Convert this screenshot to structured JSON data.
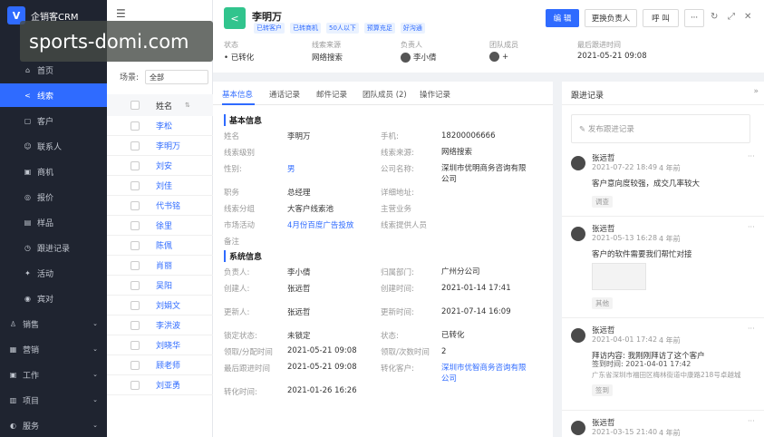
{
  "app": {
    "name": "企销客CRM",
    "logo_letter": "V"
  },
  "watermark": "sports-domi.com",
  "nav": {
    "items": [
      {
        "label": "首页",
        "icon": "home-icon",
        "glyph": "⌂"
      },
      {
        "label": "线索",
        "icon": "share-icon",
        "glyph": "<"
      },
      {
        "label": "客户",
        "icon": "customer-icon",
        "glyph": "▢"
      },
      {
        "label": "联系人",
        "icon": "contact-icon",
        "glyph": "☺"
      },
      {
        "label": "商机",
        "icon": "opportunity-icon",
        "glyph": "▣"
      },
      {
        "label": "报价",
        "icon": "quote-icon",
        "glyph": "◎"
      },
      {
        "label": "样品",
        "icon": "sample-icon",
        "glyph": "▤"
      },
      {
        "label": "跟进记录",
        "icon": "followup-icon",
        "glyph": "◷"
      },
      {
        "label": "活动",
        "icon": "activity-icon",
        "glyph": "✦"
      },
      {
        "label": "宾对",
        "icon": "compare-icon",
        "glyph": "◉"
      }
    ],
    "groups": [
      {
        "label": "销售",
        "icon": "sales-icon",
        "glyph": "♙"
      },
      {
        "label": "营销",
        "icon": "marketing-icon",
        "glyph": "▦"
      },
      {
        "label": "工作",
        "icon": "work-icon",
        "glyph": "▣"
      },
      {
        "label": "项目",
        "icon": "project-icon",
        "glyph": "▥"
      },
      {
        "label": "服务",
        "icon": "service-icon",
        "glyph": "◐"
      }
    ]
  },
  "list": {
    "scene_label": "场景:",
    "scene_value": "全部",
    "name_header": "姓名",
    "rows": [
      "李松",
      "李明万",
      "刘安",
      "刘佳",
      "代书铭",
      "徐里",
      "陈佩",
      "肖丽",
      "吴阳",
      "刘娟文",
      "李洪波",
      "刘晓华",
      "顾老师",
      "刘亚勇"
    ]
  },
  "record": {
    "title": "李明万",
    "tags": [
      "已转客户",
      "已转商机",
      "50人以下",
      "预算充足",
      "好沟通"
    ],
    "actions": {
      "edit": "编 辑",
      "owner": "更换负责人",
      "call": "呼 叫",
      "more": "···"
    },
    "summary": [
      {
        "label": "状态",
        "value": "已转化"
      },
      {
        "label": "线索来源",
        "value": "网络搜索"
      },
      {
        "label": "负责人",
        "value": "李小倩"
      },
      {
        "label": "团队成员",
        "value": "+"
      },
      {
        "label": "最后跟进时间",
        "value": "2021-05-21 09:08"
      }
    ]
  },
  "tabs": [
    "基本信息",
    "通话记录",
    "邮件记录",
    "团队成员 (2)",
    "操作记录"
  ],
  "basic": {
    "section_title": "基本信息",
    "fields": [
      {
        "label": "姓名",
        "value": "李明万",
        "label2": "手机:",
        "value2": "18200006666"
      },
      {
        "label": "线索级别",
        "value": "",
        "label2": "线索来源:",
        "value2": "网络搜索"
      },
      {
        "label": "性别:",
        "value": "男",
        "label2": "公司名称:",
        "value2": "深圳市优明商务咨询有限公司"
      },
      {
        "label": "职务",
        "value": "总经理",
        "label2": "详细地址:",
        "value2": ""
      },
      {
        "label": "线索分组",
        "value": "大客户线索池",
        "label2": "主营业务",
        "value2": ""
      },
      {
        "label": "市场活动",
        "value": "4月份百度广告投放",
        "label2": "线索提供人员",
        "value2": ""
      },
      {
        "label": "备注",
        "value": "",
        "label2": "",
        "value2": ""
      }
    ]
  },
  "system": {
    "section_title": "系统信息",
    "fields": [
      {
        "label": "负责人:",
        "value": "李小倩",
        "label2": "归属部门:",
        "value2": "广州分公司"
      },
      {
        "label": "创建人:",
        "value": "张远哲",
        "label2": "创建时间:",
        "value2": "2021-01-14 17:41"
      },
      {
        "label": "更新人:",
        "value": "张远哲",
        "label2": "更新时间:",
        "value2": "2021-07-14 16:09"
      },
      {
        "label": "锁定状态:",
        "value": "未锁定",
        "label2": "状态:",
        "value2": "已转化"
      },
      {
        "label": "领取/分配时间",
        "value": "2021-05-21 09:08",
        "label2": "领取/次数时间",
        "value2": "2"
      },
      {
        "label": "最后跟进时间",
        "value": "2021-05-21 09:08",
        "label2": "转化客户:",
        "value2": "深圳市优智商务咨询有限公司"
      },
      {
        "label": "转化时间:",
        "value": "2021-01-26 16:26",
        "label2": "",
        "value2": ""
      }
    ]
  },
  "followup": {
    "title": "跟进记录",
    "collapse": "»",
    "post_placeholder": "发布跟进记录",
    "more": "···",
    "entries": [
      {
        "name": "张远哲",
        "time": "2021-07-22 18:49",
        "ago": "4 年前",
        "text": "客户意向度较强，成交几率较大",
        "tag": "调查"
      },
      {
        "name": "张远哲",
        "time": "2021-05-13 16:28",
        "ago": "4 年前",
        "text": "客户的软件需要我们帮忙对接",
        "tag": "其他"
      },
      {
        "name": "张远哲",
        "time": "2021-04-01 17:42",
        "ago": "4 年前",
        "text": "拜访内容:  我刚刚拜访了这个客户",
        "text2": "签到时间:  2021-04-01 17:42",
        "text3": "广东省深圳市福田区梅林街道中康路218号卓越城",
        "tag": "签到"
      },
      {
        "name": "张远哲",
        "time": "2021-03-15 21:40",
        "ago": "4 年前",
        "text": "",
        "tag": ""
      }
    ]
  },
  "colors": {
    "accent": "#2f6bff",
    "sidebar": "#1f2430",
    "lead_icon": "#31c48d"
  }
}
